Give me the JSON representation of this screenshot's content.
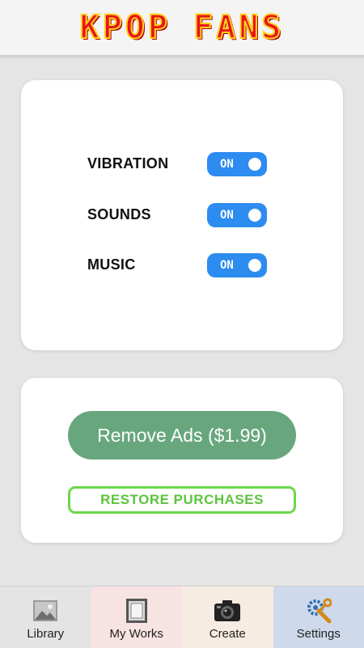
{
  "app": {
    "logo_text": "KPOP FANS"
  },
  "settings": {
    "rows": [
      {
        "label": "VIBRATION",
        "state": "ON"
      },
      {
        "label": "SOUNDS",
        "state": "ON"
      },
      {
        "label": "MUSIC",
        "state": "ON"
      }
    ]
  },
  "purchase": {
    "remove_ads_label": "Remove Ads ($1.99)",
    "restore_label": "RESTORE PURCHASES"
  },
  "tabs": [
    {
      "label": "Library",
      "icon": "library-icon",
      "bg": "#e4e4e4"
    },
    {
      "label": "My Works",
      "icon": "frame-icon",
      "bg": "#f8e3e3"
    },
    {
      "label": "Create",
      "icon": "camera-icon",
      "bg": "#f7ece2"
    },
    {
      "label": "Settings",
      "icon": "gear-wrench-icon",
      "bg": "#cfd9ec",
      "selected": true
    }
  ],
  "colors": {
    "toggle_on": "#2d8cf0",
    "remove_ads_button": "#68a77e",
    "restore_border": "#6bd84a"
  }
}
